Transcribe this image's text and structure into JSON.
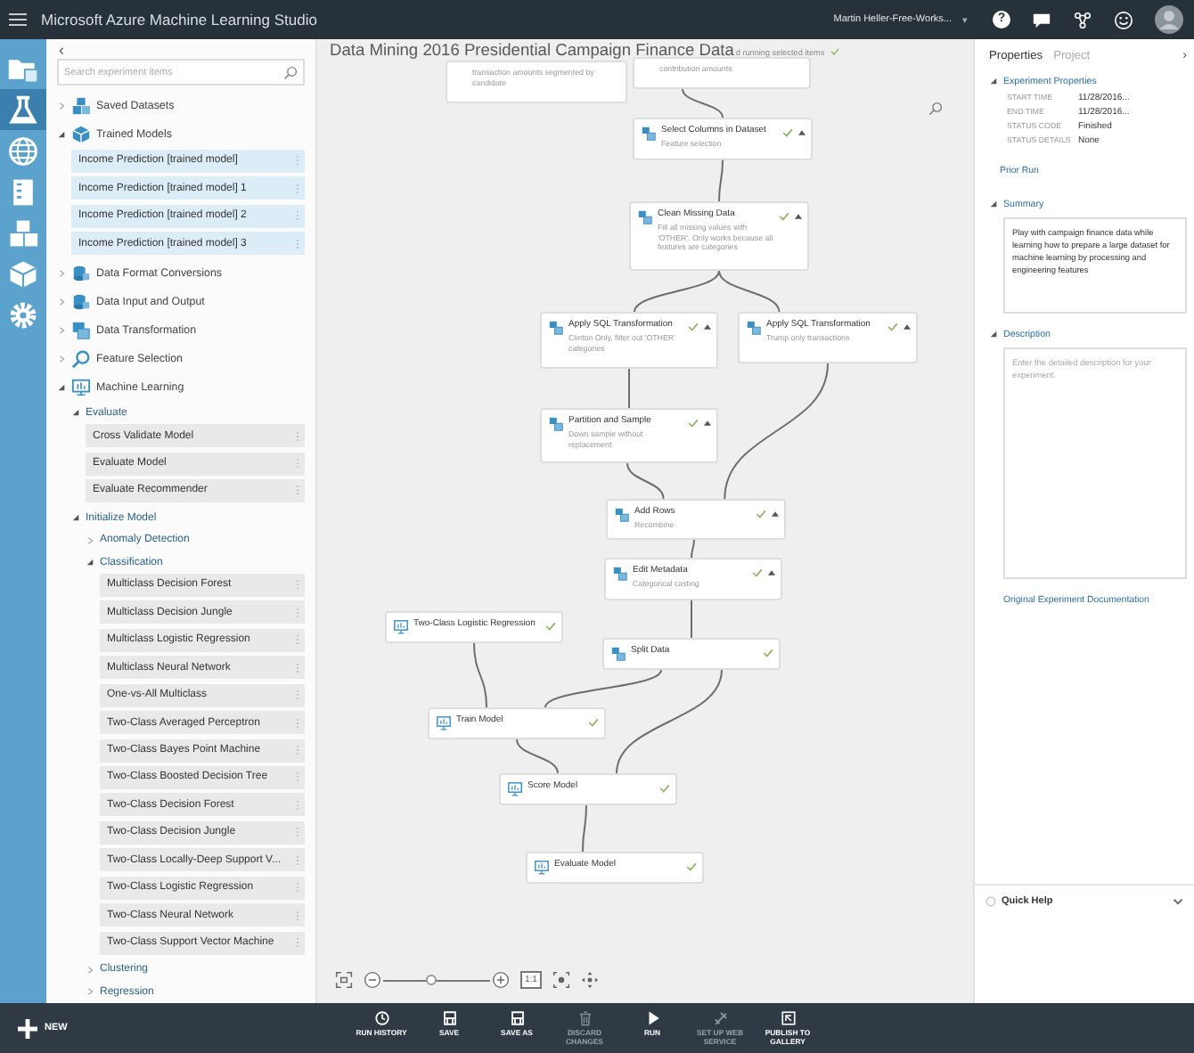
{
  "app_bar": {
    "title": "Microsoft Azure Machine Learning Studio",
    "workspace": "Martin Heller-Free-Works...",
    "workspace_caret": "▾",
    "help_glyph": "?"
  },
  "nav_rail": {
    "items": [
      {
        "selected": false
      },
      {
        "selected": true
      },
      {
        "selected": false
      },
      {
        "selected": false
      },
      {
        "selected": false
      },
      {
        "selected": false
      },
      {
        "selected": false
      }
    ]
  },
  "palette": {
    "collapse": "‹",
    "search": {
      "placeholder": "Search experiment items"
    },
    "tree": [
      {
        "kind": "group",
        "label": "Saved Datasets",
        "expanded": false
      },
      {
        "kind": "group",
        "label": "Trained Models",
        "expanded": true,
        "children": [
          {
            "kind": "trained_model",
            "label": "Income Prediction [trained model]"
          },
          {
            "kind": "trained_model",
            "label": "Income Prediction [trained model] 1"
          },
          {
            "kind": "trained_model",
            "label": "Income Prediction [trained model] 2"
          },
          {
            "kind": "trained_model",
            "label": "Income Prediction [trained model] 3"
          }
        ]
      },
      {
        "kind": "group",
        "label": "Data Format Conversions",
        "expanded": false
      },
      {
        "kind": "group",
        "label": "Data Input and Output",
        "expanded": false
      },
      {
        "kind": "group",
        "label": "Data Transformation",
        "expanded": false
      },
      {
        "kind": "group",
        "label": "Feature Selection",
        "expanded": false
      },
      {
        "kind": "group",
        "label": "Machine Learning",
        "expanded": true,
        "children": [
          {
            "kind": "group",
            "label": "Evaluate",
            "expanded": true,
            "children": [
              {
                "kind": "module",
                "label": "Cross Validate Model"
              },
              {
                "kind": "module",
                "label": "Evaluate Model"
              },
              {
                "kind": "module",
                "label": "Evaluate Recommender"
              }
            ]
          },
          {
            "kind": "group",
            "label": "Initialize Model",
            "expanded": true,
            "children": [
              {
                "kind": "group",
                "label": "Anomaly Detection",
                "expanded": false
              },
              {
                "kind": "group",
                "label": "Classification",
                "expanded": true,
                "children": [
                  {
                    "kind": "module",
                    "label": "Multiclass Decision Forest"
                  },
                  {
                    "kind": "module",
                    "label": "Multiclass Decision Jungle"
                  },
                  {
                    "kind": "module",
                    "label": "Multiclass Logistic Regression"
                  },
                  {
                    "kind": "module",
                    "label": "Multiclass Neural Network"
                  },
                  {
                    "kind": "module",
                    "label": "One-vs-All Multiclass"
                  },
                  {
                    "kind": "module",
                    "label": "Two-Class Averaged Perceptron"
                  },
                  {
                    "kind": "module",
                    "label": "Two-Class Bayes Point Machine"
                  },
                  {
                    "kind": "module",
                    "label": "Two-Class Boosted Decision Tree"
                  },
                  {
                    "kind": "module",
                    "label": "Two-Class Decision Forest"
                  },
                  {
                    "kind": "module",
                    "label": "Two-Class Decision Jungle"
                  },
                  {
                    "kind": "module",
                    "label": "Two-Class Locally-Deep Support V..."
                  },
                  {
                    "kind": "module",
                    "label": "Two-Class Logistic Regression"
                  },
                  {
                    "kind": "module",
                    "label": "Two-Class Neural Network"
                  },
                  {
                    "kind": "module",
                    "label": "Two-Class Support Vector Machine"
                  }
                ]
              },
              {
                "kind": "group",
                "label": "Clustering",
                "expanded": false
              },
              {
                "kind": "group",
                "label": "Regression",
                "expanded": false
              }
            ]
          }
        ]
      }
    ]
  },
  "canvas": {
    "title": "Data Mining 2016 Presidential Campaign Finance Data",
    "status": "d running selected items",
    "status_finished": true,
    "nodes": [
      {
        "kind": "partial",
        "description": "transaction amounts segmented by candidate"
      },
      {
        "kind": "partial",
        "description": "contribution amounts"
      },
      {
        "kind": "transform",
        "name": "Select Columns in Dataset",
        "description": "Feature selection",
        "finished": true,
        "expanded": true
      },
      {
        "kind": "transform",
        "name": "Clean Missing Data",
        "description": "Fill all missing values with 'OTHER'. Only works because all features are categories",
        "finished": true,
        "expanded": true
      },
      {
        "kind": "transform",
        "name": "Apply SQL Transformation",
        "description": "Clinton Only, filter out 'OTHER' categories",
        "finished": true,
        "expanded": true
      },
      {
        "kind": "transform",
        "name": "Apply SQL Transformation",
        "description": "Trump only transactions",
        "finished": true,
        "expanded": true
      },
      {
        "kind": "transform",
        "name": "Partition and Sample",
        "description": "Down sample without replacement",
        "finished": true,
        "expanded": true
      },
      {
        "kind": "transform",
        "name": "Add Rows",
        "description": "Recombine",
        "finished": true,
        "expanded": true
      },
      {
        "kind": "transform",
        "name": "Edit Metadata",
        "description": "Categorical casting",
        "finished": true,
        "expanded": true
      },
      {
        "kind": "model",
        "name": "Two-Class Logistic Regression",
        "finished": true
      },
      {
        "kind": "transform",
        "name": "Split Data",
        "finished": true
      },
      {
        "kind": "model",
        "name": "Train Model",
        "finished": true
      },
      {
        "kind": "model",
        "name": "Score Model",
        "finished": true
      },
      {
        "kind": "model",
        "name": "Evaluate Model",
        "finished": true
      }
    ],
    "zoom": {
      "level": 0.45,
      "actual_size": "1:1"
    }
  },
  "properties_panel": {
    "collapse": "›",
    "tabs": [
      {
        "label": "Properties",
        "selected": true
      },
      {
        "label": "Project",
        "selected": false
      }
    ],
    "experiment_properties": {
      "title": "Experiment Properties",
      "expanded": true,
      "rows": [
        {
          "key": "START TIME",
          "value": "11/28/2016..."
        },
        {
          "key": "END TIME",
          "value": "11/28/2016..."
        },
        {
          "key": "STATUS CODE",
          "value": "Finished"
        },
        {
          "key": "STATUS DETAILS",
          "value": "None"
        }
      ],
      "link": "Prior Run"
    },
    "summary": {
      "title": "Summary",
      "expanded": true,
      "value": "Play with campaign finance data while learning how to prepare a large dataset for machine learning by processing and engineering features"
    },
    "description": {
      "title": "Description",
      "expanded": true,
      "placeholder": "Enter the detailed description for your experiment."
    },
    "documentation_link": "Original Experiment Documentation",
    "quick_help": {
      "title": "Quick Help",
      "expanded": false
    }
  },
  "command_bar": {
    "new_label": "NEW",
    "buttons": [
      {
        "kind": "history",
        "label": "RUN HISTORY",
        "disabled": false
      },
      {
        "kind": "save",
        "label": "SAVE",
        "disabled": false
      },
      {
        "kind": "save",
        "label": "SAVE AS",
        "disabled": false
      },
      {
        "kind": "trash",
        "label": "DISCARD CHANGES",
        "disabled": true
      },
      {
        "kind": "run",
        "label": "RUN",
        "disabled": false
      },
      {
        "kind": "service",
        "label": "SET UP WEB SERVICE",
        "disabled": true
      },
      {
        "kind": "publish",
        "label": "PUBLISH TO GALLERY",
        "disabled": false
      }
    ]
  }
}
